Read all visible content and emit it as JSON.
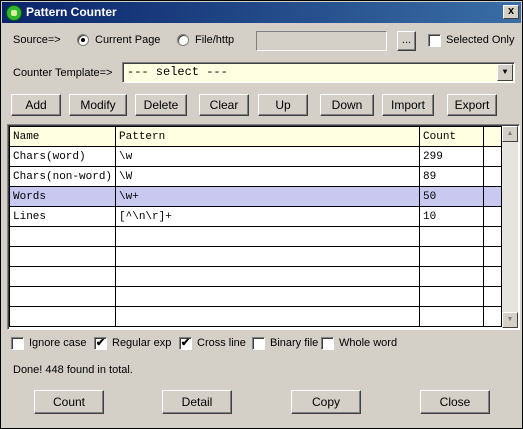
{
  "window": {
    "title": "Pattern Counter",
    "close_glyph": "x"
  },
  "source": {
    "label": "Source=>",
    "options": [
      "Current Page",
      "File/http"
    ],
    "selected": "Current Page",
    "path_value": "",
    "browse_label": "...",
    "selected_only_label": "Selected Only",
    "selected_only_checked": false
  },
  "template": {
    "label": "Counter Template=>",
    "value": "--- select ---",
    "arrow_glyph": "▼"
  },
  "toolbar": [
    "Add",
    "Modify",
    "Delete",
    "Clear",
    "Up",
    "Down",
    "Import",
    "Export"
  ],
  "table": {
    "columns": [
      "Name",
      "Pattern",
      "Count"
    ],
    "rows": [
      [
        "Chars(word)",
        "\\w",
        "299"
      ],
      [
        "Chars(non-word)",
        "\\W",
        "89"
      ],
      [
        "Words",
        "\\w+",
        "50"
      ],
      [
        "Lines",
        "[^\\n\\r]+",
        "10"
      ]
    ],
    "selected_row": 2,
    "empty_rows": 5
  },
  "scrollbar": {
    "up_glyph": "▲",
    "down_glyph": "▼"
  },
  "options": [
    {
      "label": "Ignore case",
      "checked": false
    },
    {
      "label": "Regular exp",
      "checked": true
    },
    {
      "label": "Cross line",
      "checked": true
    },
    {
      "label": "Binary file",
      "checked": false
    },
    {
      "label": "Whole word",
      "checked": false
    }
  ],
  "check_glyph": "✔",
  "status": "Done! 448 found in total.",
  "bottom_buttons": [
    "Count",
    "Detail",
    "Copy",
    "Close"
  ]
}
